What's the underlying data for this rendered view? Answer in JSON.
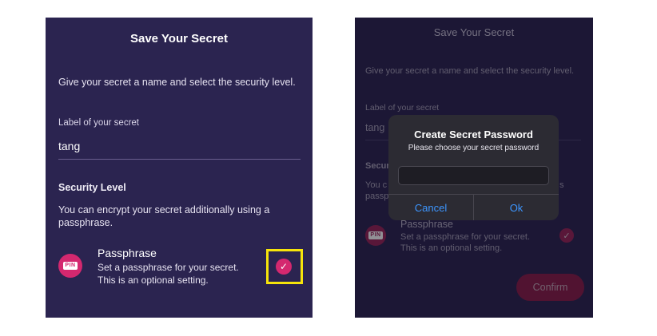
{
  "left": {
    "title": "Save Your Secret",
    "intro": "Give your secret a name and select the security level.",
    "label_caption": "Label of your secret",
    "label_value": "tang",
    "security_heading": "Security Level",
    "security_desc": "You can encrypt your secret additionally using a passphrase.",
    "option_icon": "PIN",
    "option_title": "Passphrase",
    "option_desc": "Set a passphrase for your secret. This is an optional setting.",
    "checkmark": "✓"
  },
  "right": {
    "title": "Save Your Secret",
    "intro": "Give your secret a name and select the security level.",
    "label_caption": "Label of your secret",
    "label_value": "tang",
    "security_heading_partial": "Secur",
    "security_desc_partial_1": "You c",
    "security_desc_partial_2": "passp",
    "security_desc_partial_right": "s",
    "option_icon": "PIN",
    "option_title": "Passphrase",
    "option_desc": "Set a passphrase for your secret. This is an optional setting.",
    "checkmark": "✓",
    "confirm_label": "Confirm",
    "dialog": {
      "title": "Create Secret Password",
      "message": "Please choose your secret password",
      "input_value": "",
      "cancel_label": "Cancel",
      "ok_label": "Ok"
    }
  },
  "colors": {
    "background": "#2b2450",
    "accent": "#d4286f",
    "highlight": "#f6e40b",
    "dialog_button": "#3d96ff"
  }
}
